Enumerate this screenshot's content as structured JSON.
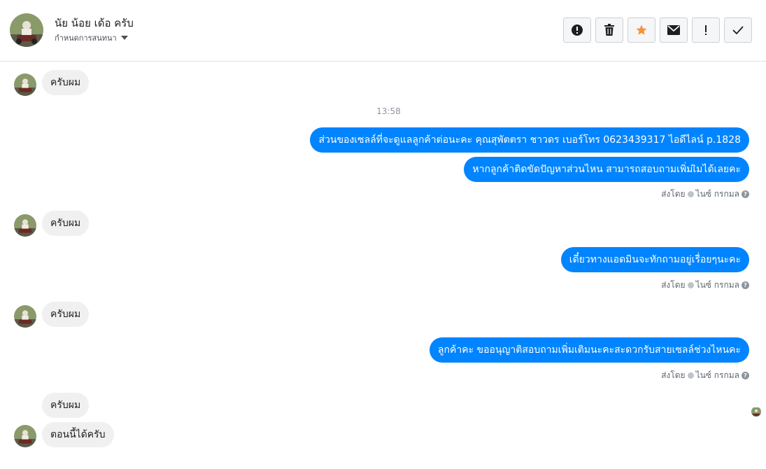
{
  "header": {
    "contact_name": "นัย น้อย เด้อ ครับ",
    "assign_label": "กำหนดการสนทนา",
    "actions": [
      "spam-alert",
      "delete",
      "star",
      "mark-unread",
      "important",
      "mark-done"
    ]
  },
  "colors": {
    "outgoing": "#0084ff",
    "incoming": "#f1f0f0",
    "star": "#f7923a"
  },
  "messages": {
    "in_1": "ครับผม",
    "timestamp": "13:58",
    "out_1": "ส่วนของเซลล์ที่จะดูแลลูกค้าต่อนะคะ คุณสุพัตตรา   ชาวดร เบอร์โทร 0623439317  ไอดีไลน์ p.1828",
    "out_2": "หากลูกค้าติดขัดปัญหาส่วนไหน สามารถสอบถามเพิ่มเิมได้เลยคะ",
    "sent_by_1": "ส่งโดย",
    "sender_1": "ไนซ์ กรกมล",
    "in_2": "ครับผม",
    "out_3": "เดี๋ยวทางแอดมินจะทักถามอยู่เรื่อยๆนะคะ",
    "sent_by_2": "ส่งโดย",
    "sender_2": "ไนซ์ กรกมล",
    "in_3": "ครับผม",
    "out_4": "ลูกค้าคะ ขออนุญาติสอบถามเพิ่มเติมนะคะสะดวกรับสายเซลล์ช่วงไหนคะ",
    "sent_by_3": "ส่งโดย",
    "sender_3": "ไนซ์ กรกมล",
    "in_4": "ครับผม",
    "in_5": "ตอนนี้ได้ครับ"
  }
}
